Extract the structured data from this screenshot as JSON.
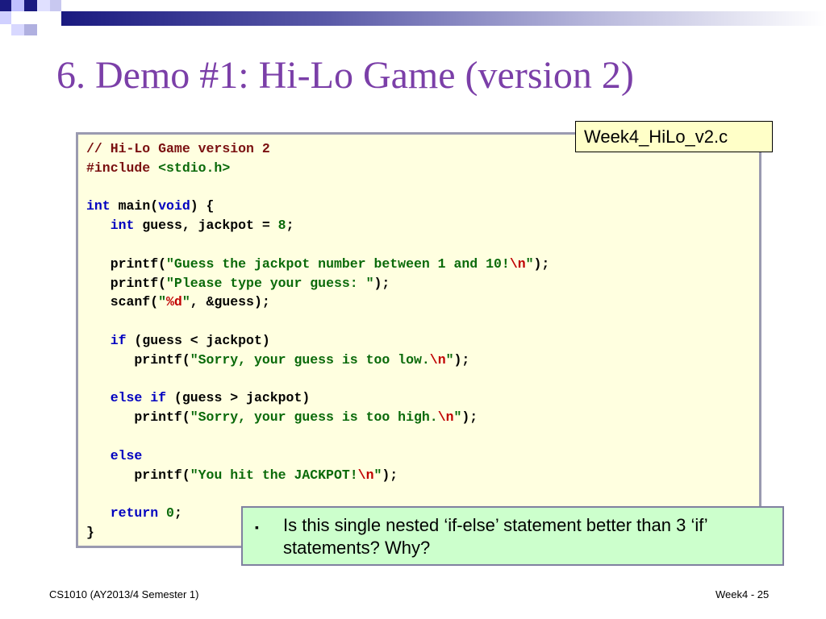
{
  "slide": {
    "title": "6. Demo #1: Hi-Lo Game (version 2)",
    "file_label": "Week4_HiLo_v2.c",
    "code_lines": [
      [
        {
          "t": "// Hi-Lo Game version 2",
          "c": "cm"
        }
      ],
      [
        {
          "t": "#include ",
          "c": "cm"
        },
        {
          "t": "<stdio.h>",
          "c": "st"
        }
      ],
      [],
      [
        {
          "t": "int",
          "c": "kw"
        },
        {
          "t": " main(",
          "c": ""
        },
        {
          "t": "void",
          "c": "kw"
        },
        {
          "t": ") {",
          "c": ""
        }
      ],
      [
        {
          "t": "   ",
          "c": ""
        },
        {
          "t": "int",
          "c": "kw"
        },
        {
          "t": " guess, jackpot = ",
          "c": ""
        },
        {
          "t": "8",
          "c": "st"
        },
        {
          "t": ";",
          "c": ""
        }
      ],
      [],
      [
        {
          "t": "   printf(",
          "c": ""
        },
        {
          "t": "\"Guess the jackpot number between 1 and 10!",
          "c": "st"
        },
        {
          "t": "\\n",
          "c": "es"
        },
        {
          "t": "\"",
          "c": "st"
        },
        {
          "t": ");",
          "c": ""
        }
      ],
      [
        {
          "t": "   printf(",
          "c": ""
        },
        {
          "t": "\"Please type your guess: \"",
          "c": "st"
        },
        {
          "t": ");",
          "c": ""
        }
      ],
      [
        {
          "t": "   scanf(",
          "c": ""
        },
        {
          "t": "\"",
          "c": "st"
        },
        {
          "t": "%d",
          "c": "es"
        },
        {
          "t": "\"",
          "c": "st"
        },
        {
          "t": ", &guess);",
          "c": ""
        }
      ],
      [],
      [
        {
          "t": "   ",
          "c": ""
        },
        {
          "t": "if",
          "c": "kw"
        },
        {
          "t": " (guess < jackpot)",
          "c": ""
        }
      ],
      [
        {
          "t": "      printf(",
          "c": ""
        },
        {
          "t": "\"Sorry, your guess is too low.",
          "c": "st"
        },
        {
          "t": "\\n",
          "c": "es"
        },
        {
          "t": "\"",
          "c": "st"
        },
        {
          "t": ");",
          "c": ""
        }
      ],
      [],
      [
        {
          "t": "   ",
          "c": ""
        },
        {
          "t": "else if",
          "c": "kw"
        },
        {
          "t": " (guess > jackpot)",
          "c": ""
        }
      ],
      [
        {
          "t": "      printf(",
          "c": ""
        },
        {
          "t": "\"Sorry, your guess is too high.",
          "c": "st"
        },
        {
          "t": "\\n",
          "c": "es"
        },
        {
          "t": "\"",
          "c": "st"
        },
        {
          "t": ");",
          "c": ""
        }
      ],
      [],
      [
        {
          "t": "   ",
          "c": ""
        },
        {
          "t": "else",
          "c": "kw"
        }
      ],
      [
        {
          "t": "      printf(",
          "c": ""
        },
        {
          "t": "\"You hit the JACKPOT!",
          "c": "st"
        },
        {
          "t": "\\n",
          "c": "es"
        },
        {
          "t": "\"",
          "c": "st"
        },
        {
          "t": ");",
          "c": ""
        }
      ],
      [],
      [
        {
          "t": "   ",
          "c": ""
        },
        {
          "t": "return",
          "c": "kw"
        },
        {
          "t": " ",
          "c": ""
        },
        {
          "t": "0",
          "c": "st"
        },
        {
          "t": ";",
          "c": ""
        }
      ],
      [
        {
          "t": "}",
          "c": ""
        }
      ]
    ],
    "note": {
      "bullet": "▪",
      "text": "Is this single nested ‘if-else’ statement better than 3 ‘if’ statements? Why?"
    },
    "footer": {
      "left": "CS1010 (AY2013/4 Semester 1)",
      "right": "Week4 - 25"
    }
  },
  "colors": {
    "title": "#7b3fa8",
    "keyword": "#0000c0",
    "string": "#0a6a0a",
    "escape": "#c00000",
    "comment": "#7a1010",
    "code_bg": "#ffffe0",
    "note_bg": "#ccffcc"
  }
}
